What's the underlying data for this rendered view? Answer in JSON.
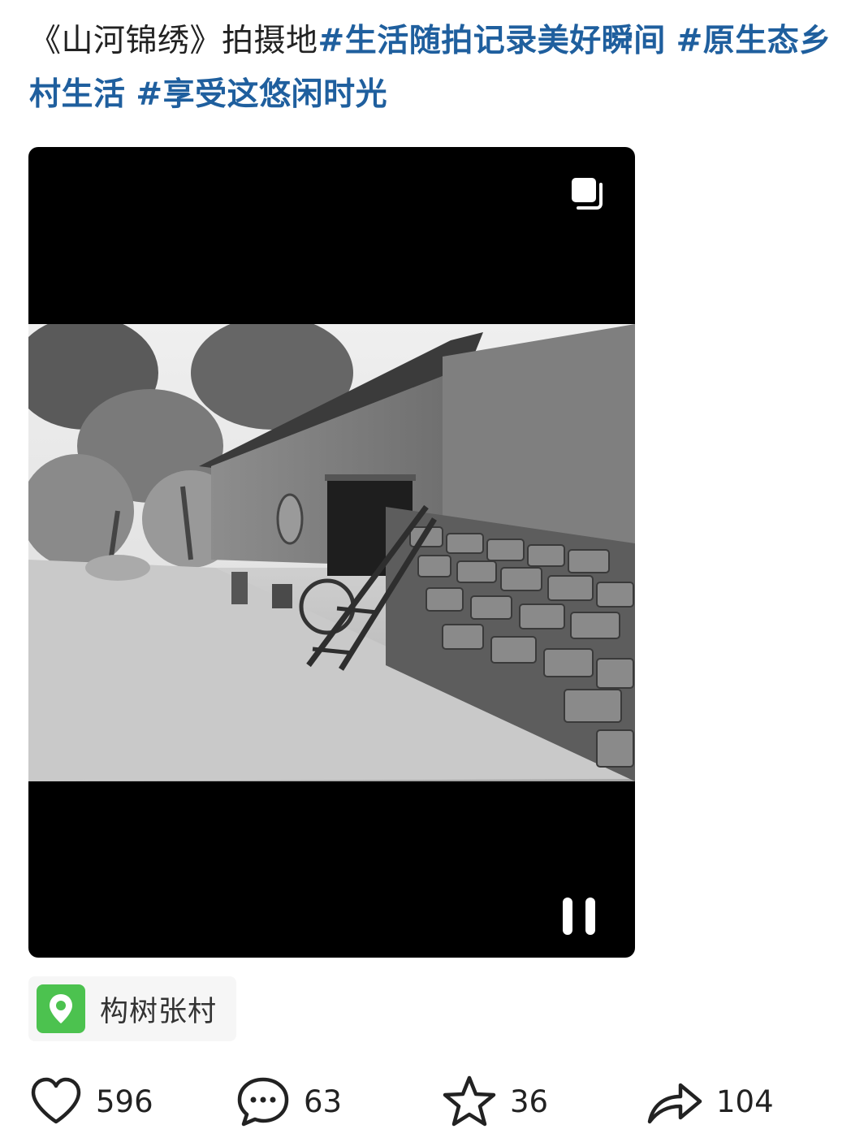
{
  "post": {
    "text_plain": "《山河锦绣》拍摄地",
    "tags": [
      "#生活随拍记录美好瞬间",
      "#原生态乡村生活",
      "#享受这悠闲时光"
    ]
  },
  "media": {
    "multi_image_icon": "multi-image-icon",
    "pause_icon": "pause-icon"
  },
  "location": {
    "icon": "map-pin-icon",
    "label": "构树张村"
  },
  "actions": {
    "like": {
      "icon": "heart-icon",
      "count": "596"
    },
    "comment": {
      "icon": "comment-bubble-icon",
      "count": "63"
    },
    "favorite": {
      "icon": "star-icon",
      "count": "36"
    },
    "share": {
      "icon": "share-arrow-icon",
      "count": "104"
    }
  },
  "colors": {
    "hashtag": "#1f5f9e",
    "location_icon_bg": "#4cc24f",
    "media_bg": "#000000"
  }
}
